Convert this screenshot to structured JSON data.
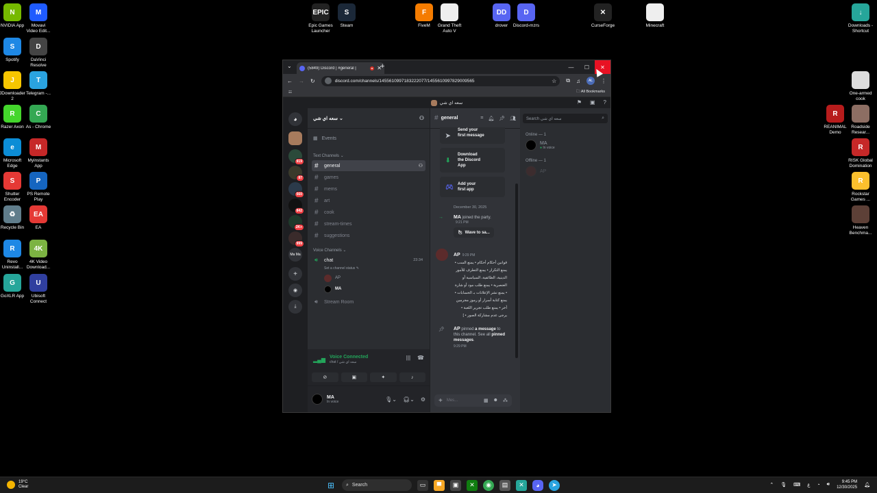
{
  "desktop": {
    "icons": [
      {
        "label": "NVIDIA App",
        "glyph": "N",
        "color": "#76b900"
      },
      {
        "label": "Movavi\nVideo Edit...",
        "glyph": "M",
        "color": "#1f5bff"
      },
      {
        "label": "Spotify",
        "glyph": "S",
        "color": "#1e88e5"
      },
      {
        "label": "DaVinci\nResolve",
        "glyph": "D",
        "color": "#444"
      },
      {
        "label": "JDownloader\n2",
        "glyph": "J",
        "color": "#f7c600"
      },
      {
        "label": "Telegram -...",
        "glyph": "T",
        "color": "#2aa3e0"
      },
      {
        "label": "Razer Axon",
        "glyph": "R",
        "color": "#44d62c"
      },
      {
        "label": "As - Chrome",
        "glyph": "C",
        "color": "#34a853"
      },
      {
        "label": "Microsoft\nEdge",
        "glyph": "e",
        "color": "#0c8dd6"
      },
      {
        "label": "Myinstants\nApp",
        "glyph": "M",
        "color": "#c62828"
      },
      {
        "label": "Shutter\nEncoder",
        "glyph": "S",
        "color": "#e53935"
      },
      {
        "label": "PS Remote\nPlay",
        "glyph": "P",
        "color": "#1565c0"
      },
      {
        "label": "Recycle Bin",
        "glyph": "♻",
        "color": "#607d8b"
      },
      {
        "label": "EA",
        "glyph": "EA",
        "color": "#e53935"
      },
      {
        "label": "Revo\nUninstall...",
        "glyph": "R",
        "color": "#1e88e5"
      },
      {
        "label": "4K Video\nDownload...",
        "glyph": "4K",
        "color": "#7cb342"
      },
      {
        "label": "GoXLR App",
        "glyph": "G",
        "color": "#26a69a"
      },
      {
        "label": "Ubisoft\nConnect",
        "glyph": "U",
        "color": "#303f9f"
      },
      {
        "label": "Epic Games\nLauncher",
        "glyph": "EPIC",
        "color": "#222"
      },
      {
        "label": "Steam",
        "glyph": "S",
        "color": "#1b2838"
      },
      {
        "label": "FiveM",
        "glyph": "F",
        "color": "#f57c00"
      },
      {
        "label": "Grand Theft\nAuto V",
        "glyph": "",
        "color": "#eeeeee"
      },
      {
        "label": "drover",
        "glyph": "DD",
        "color": "#5865f2"
      },
      {
        "label": "Discord-mzrs",
        "glyph": "D",
        "color": "#5865f2"
      },
      {
        "label": "CurseForge",
        "glyph": "✕",
        "color": "#222"
      },
      {
        "label": "Minecraft",
        "glyph": "",
        "color": "#eeeeee"
      },
      {
        "label": "Downloads -\nShortcut",
        "glyph": "↓",
        "color": "#26a69a"
      },
      {
        "label": "One-armed\ncook",
        "glyph": "",
        "color": "#ddd"
      },
      {
        "label": "REANIMAL\nDemo",
        "glyph": "R",
        "color": "#b71c1c"
      },
      {
        "label": "Roadside\nResear...",
        "glyph": "",
        "color": "#8d6e63"
      },
      {
        "label": "RISK Global\nDomination",
        "glyph": "R",
        "color": "#c62828"
      },
      {
        "label": "Rockstar\nGames ...",
        "glyph": "R",
        "color": "#fbc02d"
      },
      {
        "label": "Heaven\nBenchma...",
        "glyph": "",
        "color": "#5d4037"
      }
    ]
  },
  "browser": {
    "tab_title": "(5849) Discord | #general |",
    "url": "discord.com/channels/1455610997183222077/1455610997829009565",
    "bookmarks_label": "All Bookmarks",
    "profile": "AL"
  },
  "discord": {
    "server_name": "سعه اي شي",
    "guild_badges": [
      "919",
      "87",
      "560",
      "842",
      "2K+",
      "999"
    ],
    "events_label": "Events",
    "text_category": "Text Channels",
    "text_channels": [
      "general",
      "games",
      "mems",
      "art",
      "cook",
      "stream-times",
      "suggestions"
    ],
    "voice_category": "Voice Channels",
    "voice_channel": {
      "name": "chat",
      "timer": "23:34",
      "status": "Set a channel status"
    },
    "voice_users": [
      "AP",
      "MA"
    ],
    "stream_room": "Stream Room",
    "voice_connected": {
      "title": "Voice Connected",
      "sub": "chat / سعه اي شي"
    },
    "user": {
      "name": "MA",
      "status": "In voice"
    },
    "chat": {
      "channel": "general",
      "cards": [
        "Send your\nfirst message",
        "Download\nthe Discord\nApp",
        "Add your\nfirst app"
      ],
      "date": "December 30, 2025",
      "join_user": "MA",
      "join_text": "joined the party.",
      "join_time": "9:21 PM",
      "wave_label": "Wave to sa...",
      "ap_name": "AP",
      "ap_time": "9:29 PM",
      "ap_text": "قوانين أحكام أحكام • يمنع السب • يمنع التكرار • يمنع التطرف للأمور الدينية، الطائفية، السياسية أو العنصرية • يمنع طلب مود أو شارة • يمنع نشر الإعلانات بـ الحسابات • يمنع كتابة أسرار أو رموز مجرمين أخر • يمنع طلب تجرير اللعبة • يرجى عدم مشاركة الصور • ]",
      "pin_user": "AP",
      "pin_text_1": "pinned",
      "pin_link": "a message",
      "pin_text_2": "to this channel. See all",
      "pin_link2": "pinned messages",
      "pin_time": "9:29 PM",
      "input_placeholder": "Mes..."
    },
    "members": {
      "search_placeholder": "Search سعه اي شي",
      "online_header": "Online — 1",
      "online": [
        {
          "name": "MA",
          "status": "In voice"
        }
      ],
      "offline_header": "Offline — 1",
      "offline": [
        {
          "name": "AP"
        }
      ]
    }
  },
  "taskbar": {
    "weather_temp": "19°C",
    "weather_desc": "Clear",
    "search_label": "Search",
    "time": "9:45 PM",
    "date": "12/30/2025"
  }
}
